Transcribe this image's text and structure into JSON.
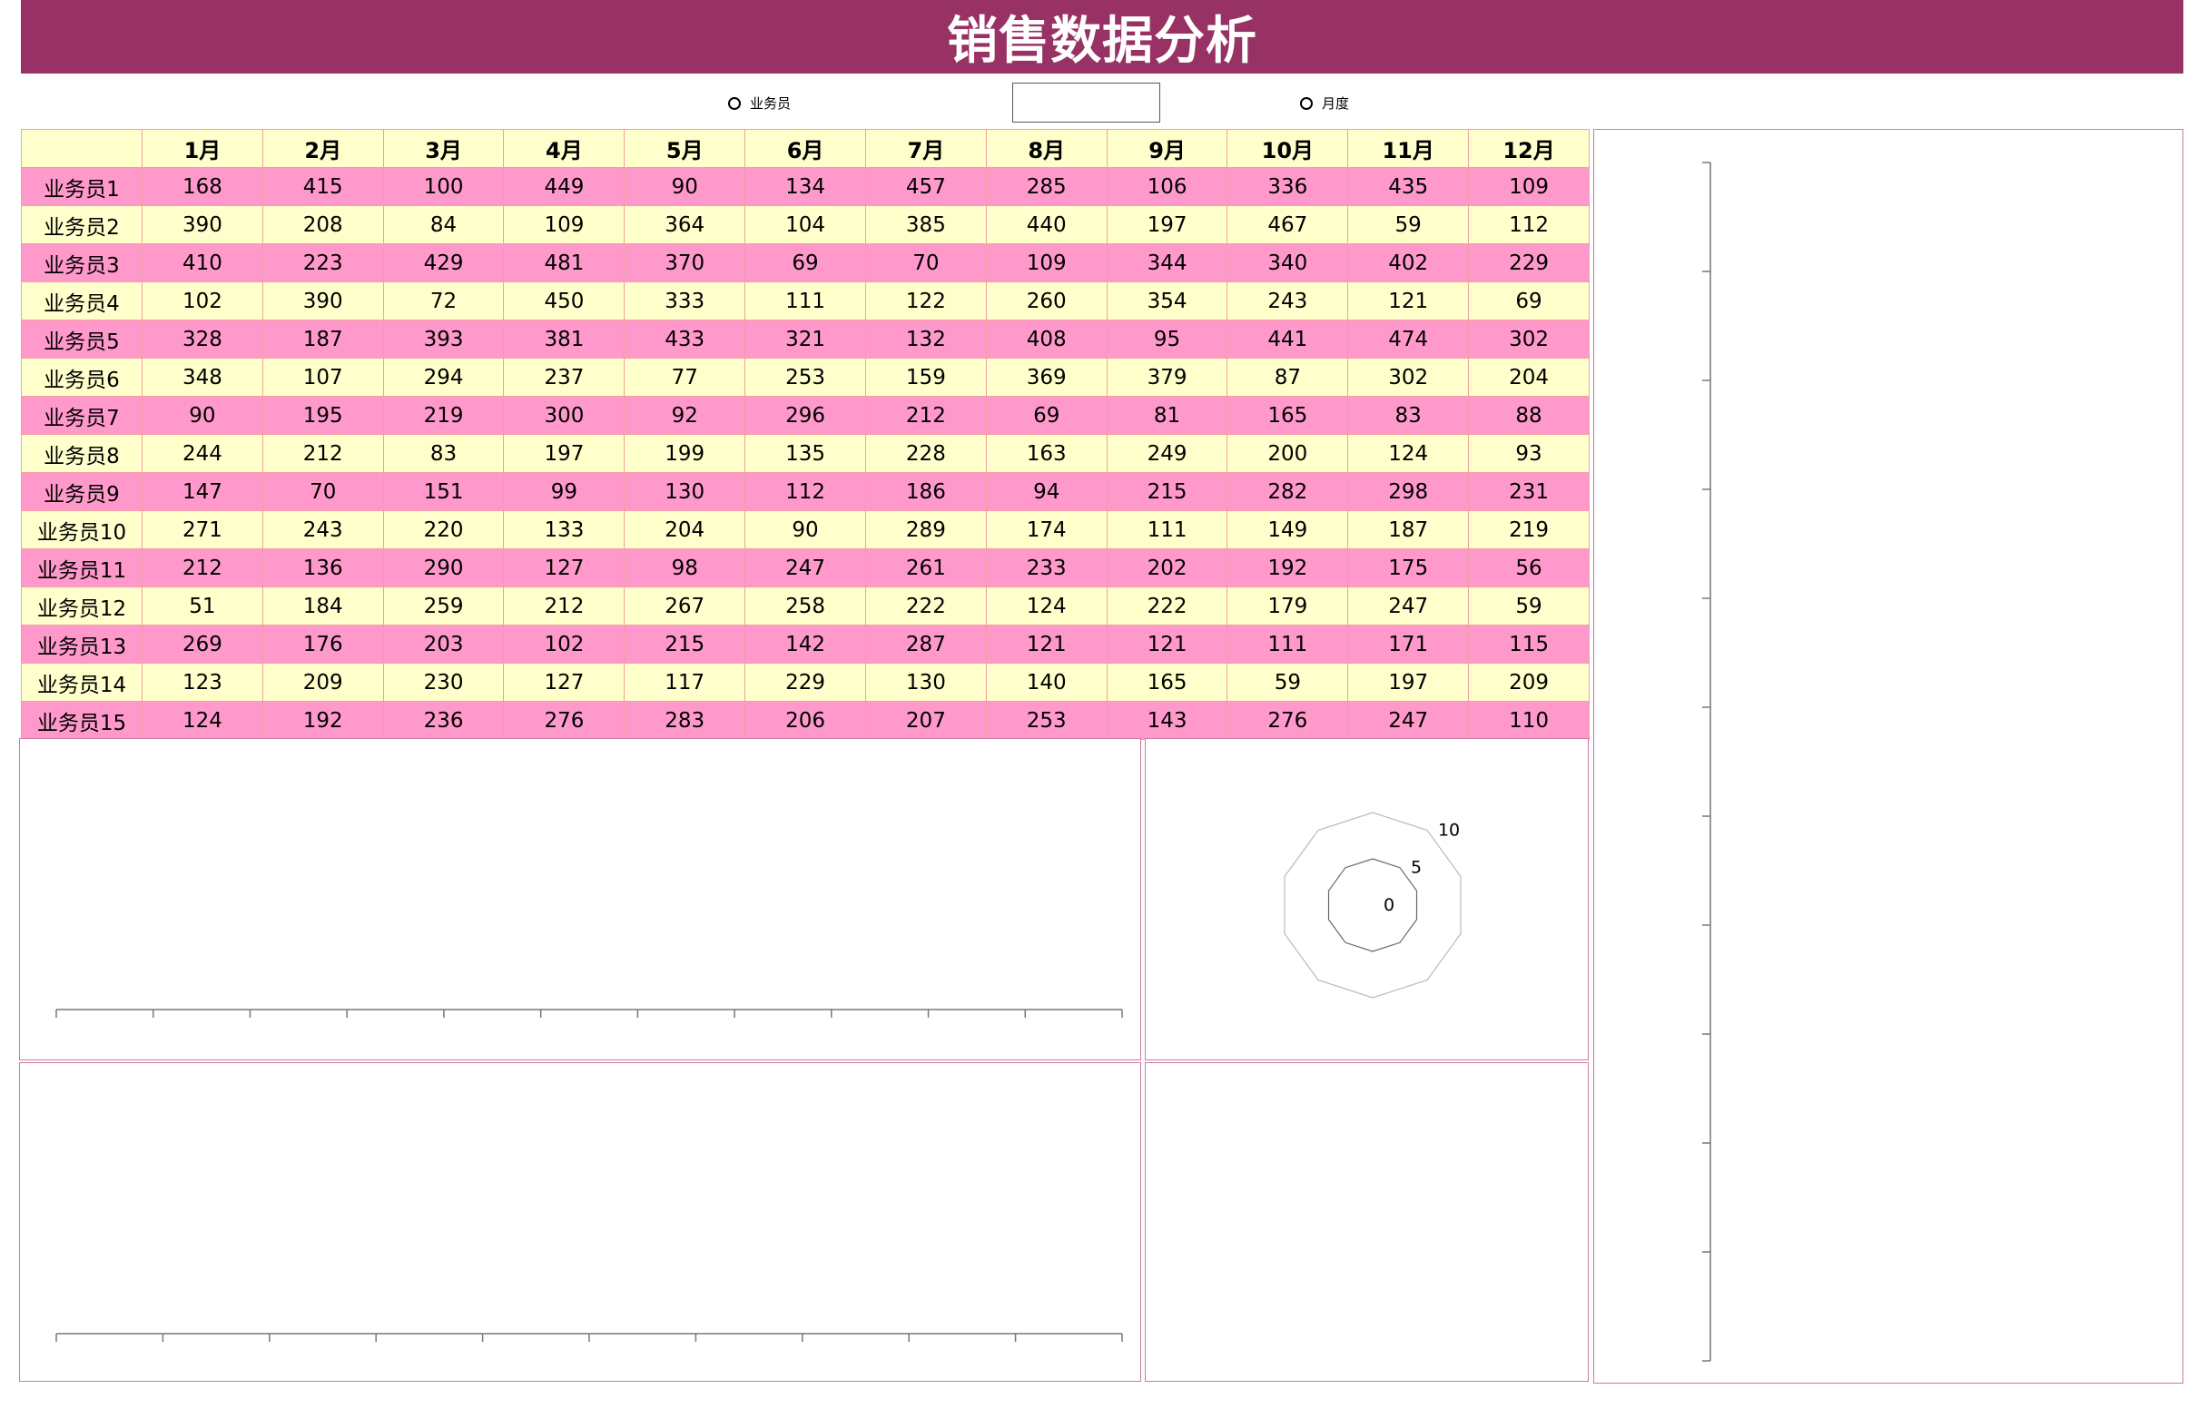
{
  "title": "销售数据分析",
  "controls": {
    "radio_salesperson": "业务员",
    "radio_month": "月度",
    "select_value": ""
  },
  "table": {
    "columns": [
      "1月",
      "2月",
      "3月",
      "4月",
      "5月",
      "6月",
      "7月",
      "8月",
      "9月",
      "10月",
      "11月",
      "12月"
    ],
    "rows": [
      {
        "name": "业务员1",
        "values": [
          168,
          415,
          100,
          449,
          90,
          134,
          457,
          285,
          106,
          336,
          435,
          109
        ]
      },
      {
        "name": "业务员2",
        "values": [
          390,
          208,
          84,
          109,
          364,
          104,
          385,
          440,
          197,
          467,
          59,
          112
        ]
      },
      {
        "name": "业务员3",
        "values": [
          410,
          223,
          429,
          481,
          370,
          69,
          70,
          109,
          344,
          340,
          402,
          229
        ]
      },
      {
        "name": "业务员4",
        "values": [
          102,
          390,
          72,
          450,
          333,
          111,
          122,
          260,
          354,
          243,
          121,
          69
        ]
      },
      {
        "name": "业务员5",
        "values": [
          328,
          187,
          393,
          381,
          433,
          321,
          132,
          408,
          95,
          441,
          474,
          302
        ]
      },
      {
        "name": "业务员6",
        "values": [
          348,
          107,
          294,
          237,
          77,
          253,
          159,
          369,
          379,
          87,
          302,
          204
        ]
      },
      {
        "name": "业务员7",
        "values": [
          90,
          195,
          219,
          300,
          92,
          296,
          212,
          69,
          81,
          165,
          83,
          88
        ]
      },
      {
        "name": "业务员8",
        "values": [
          244,
          212,
          83,
          197,
          199,
          135,
          228,
          163,
          249,
          200,
          124,
          93
        ]
      },
      {
        "name": "业务员9",
        "values": [
          147,
          70,
          151,
          99,
          130,
          112,
          186,
          94,
          215,
          282,
          298,
          231
        ]
      },
      {
        "name": "业务员10",
        "values": [
          271,
          243,
          220,
          133,
          204,
          90,
          289,
          174,
          111,
          149,
          187,
          219
        ]
      },
      {
        "name": "业务员11",
        "values": [
          212,
          136,
          290,
          127,
          98,
          247,
          261,
          233,
          202,
          192,
          175,
          56
        ]
      },
      {
        "name": "业务员12",
        "values": [
          51,
          184,
          259,
          212,
          267,
          258,
          222,
          124,
          222,
          179,
          247,
          59
        ]
      },
      {
        "name": "业务员13",
        "values": [
          269,
          176,
          203,
          102,
          215,
          142,
          287,
          121,
          121,
          111,
          171,
          115
        ]
      },
      {
        "name": "业务员14",
        "values": [
          123,
          209,
          230,
          127,
          117,
          229,
          130,
          140,
          165,
          59,
          197,
          209
        ]
      },
      {
        "name": "业务员15",
        "values": [
          124,
          192,
          236,
          276,
          283,
          206,
          207,
          253,
          143,
          276,
          247,
          110
        ]
      }
    ]
  },
  "chart_data": [
    {
      "type": "bar",
      "categories": [],
      "values": [],
      "x_tick_count": 11
    },
    {
      "type": "radar",
      "axis_count": 10,
      "r_ticks": [
        0,
        5,
        10
      ],
      "rlim": [
        0,
        10
      ]
    },
    {
      "type": "bar",
      "categories": [],
      "values": [],
      "x_tick_count": 10
    },
    {
      "type": "pie",
      "categories": [],
      "values": []
    },
    {
      "type": "bar",
      "orientation": "horizontal",
      "categories": [],
      "values": [],
      "y_tick_count": 11
    }
  ],
  "colors": {
    "header": "#983164",
    "row_pink": "#ff99cc",
    "row_yellow": "#ffffcc",
    "panel_border": "#c97ba3"
  }
}
